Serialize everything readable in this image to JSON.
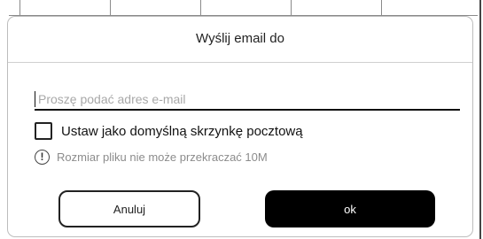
{
  "dialog": {
    "title": "Wyślij email do",
    "email_placeholder": "Proszę podać adres e-mail",
    "default_checkbox_label": "Ustaw jako domyślną skrzynkę pocztową",
    "default_checkbox_checked": false,
    "size_notice": "Rozmiar pliku nie może przekraczać 10M",
    "info_icon": "info-icon",
    "cancel_label": "Anuluj",
    "ok_label": "ok"
  },
  "colors": {
    "ok_button_bg": "#000000",
    "notice_text": "#8c8c8c",
    "dialog_border": "#bdbdbd"
  }
}
